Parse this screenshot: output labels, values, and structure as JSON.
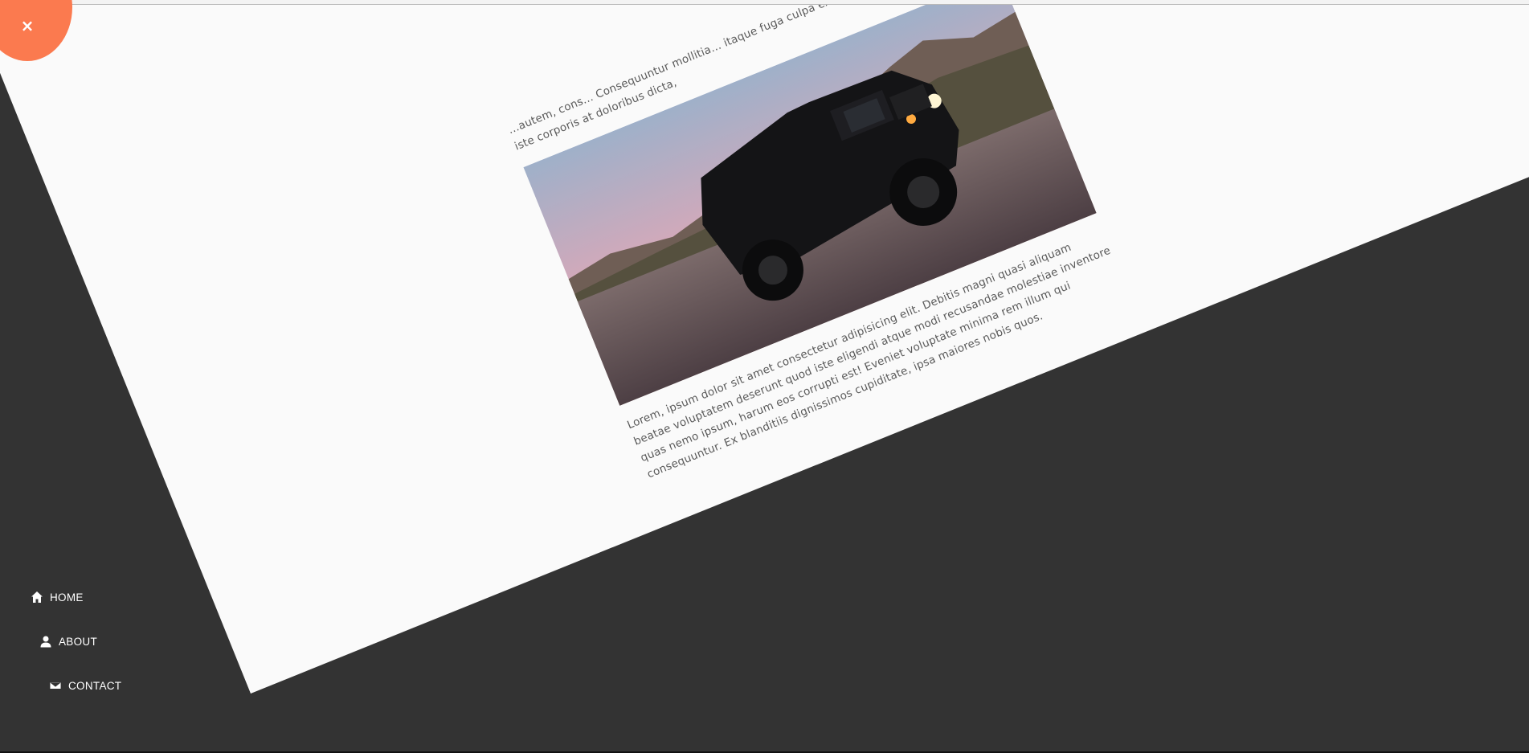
{
  "close_button": {
    "icon": "close-icon",
    "glyph": "×",
    "color": "#fb7a4f"
  },
  "nav": {
    "items": [
      {
        "label": "HOME",
        "icon": "home-icon"
      },
      {
        "label": "ABOUT",
        "icon": "user-icon"
      },
      {
        "label": "CONTACT",
        "icon": "envelope-icon"
      }
    ]
  },
  "article": {
    "intro_text": "…autem, cons… Consequuntur mollitia… itaque fuga culpa ex ipsam tempo… praesentium iste corporis at doloribus dicta,",
    "image_alt": "Black jeep on a desert road at dusk",
    "body_text": "Lorem, ipsum dolor sit amet consectetur adipisicing elit. Debitis magni quasi aliquam beatae voluptatem deserunt quod iste eligendi atque modi recusandae molestiae inventore quas nemo ipsum, harum eos corrupti est! Eveniet voluptate minima rem illum qui consequuntur. Ex blanditiis dignissimos cupiditate, ipsa maiores nobis quos."
  },
  "colors": {
    "background": "#333333",
    "page": "#fafafa",
    "accent": "#fb7a4f",
    "text": "#5a5a5a"
  }
}
